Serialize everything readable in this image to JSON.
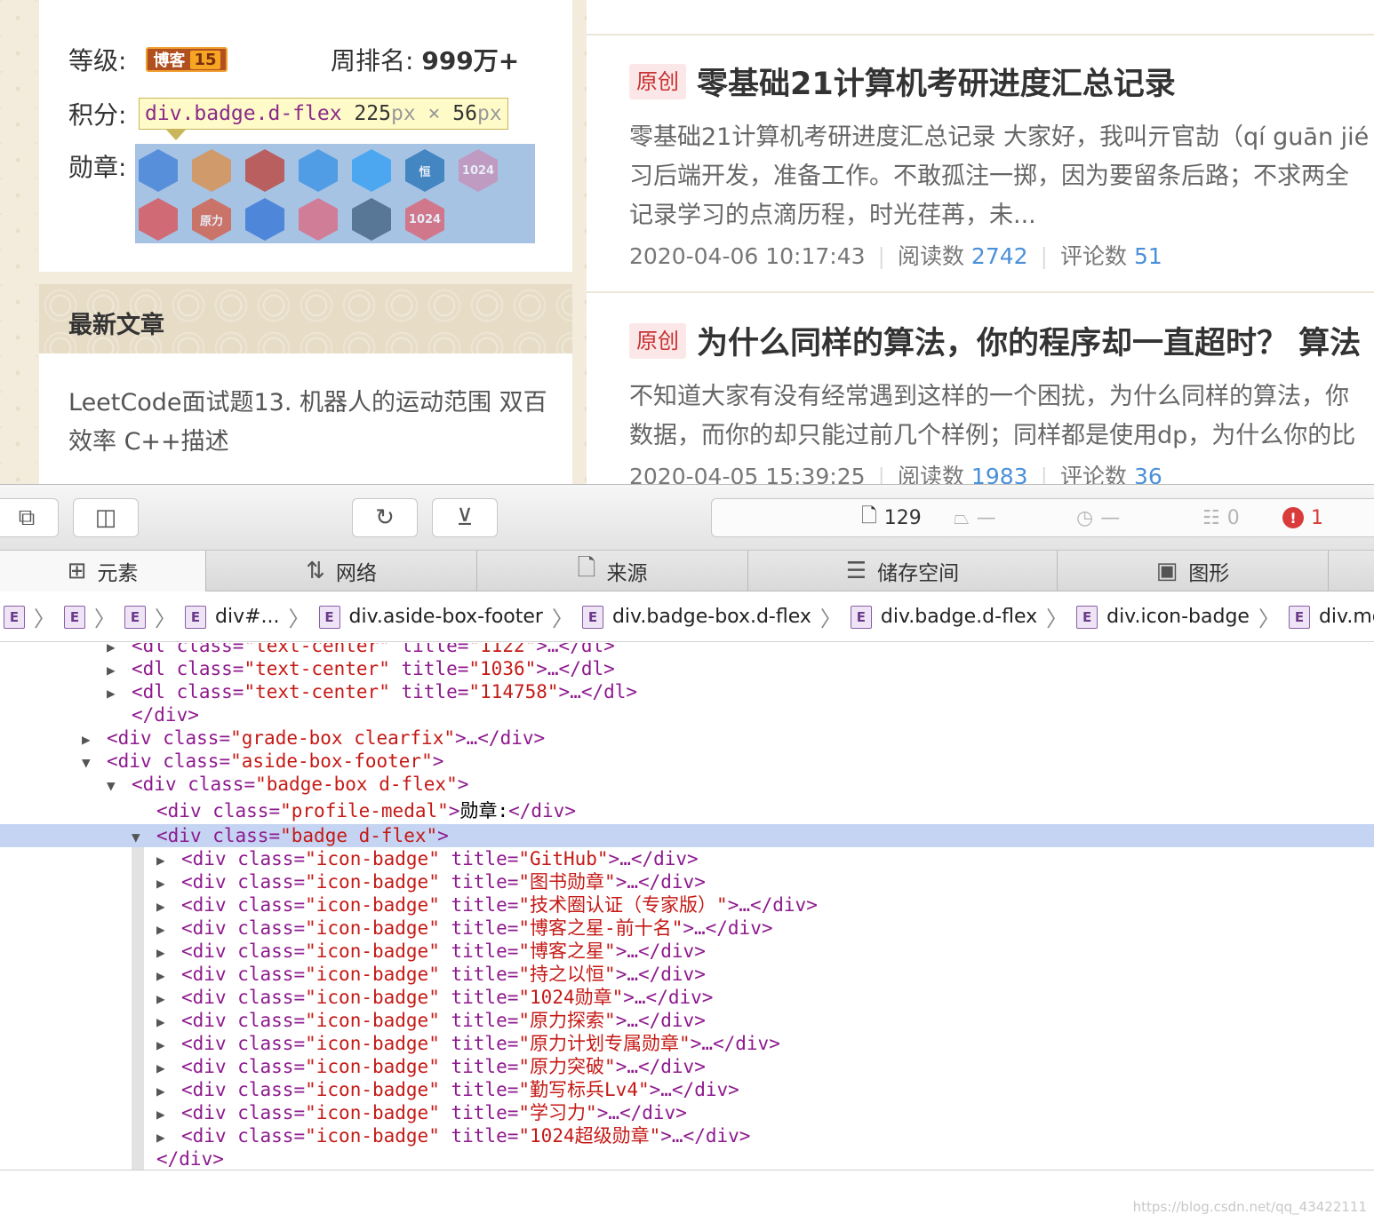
{
  "aside": {
    "level_label": "等级:",
    "level_badge_text": "博客",
    "level_badge_num": "15",
    "rank_label": "周排名:",
    "rank_value": "999万+",
    "points_label": "积分:",
    "medal_label": "勋章:",
    "tooltip": {
      "selector": "div.badge.d-flex",
      "width": "225",
      "height": "56",
      "unit": "px",
      "times": "×"
    },
    "badges": [
      {
        "name": "GitHub",
        "glyph": "",
        "color": "#3a7bd5"
      },
      {
        "name": "图书勋章",
        "glyph": "",
        "color": "#e08b3a"
      },
      {
        "name": "技术圈认证（专家版）",
        "glyph": "",
        "color": "#c0392b"
      },
      {
        "name": "博客之星-前十名",
        "glyph": "",
        "color": "#2f8de4"
      },
      {
        "name": "博客之星",
        "glyph": "",
        "color": "#2a9df4"
      },
      {
        "name": "持之以恒",
        "glyph": "恒",
        "color": "#1f6fb5"
      },
      {
        "name": "1024勋章",
        "glyph": "1024",
        "color": "#c98bb3"
      },
      {
        "name": "原力探索",
        "glyph": "",
        "color": "#e04848"
      },
      {
        "name": "原力计划专属勋章",
        "glyph": "原力",
        "color": "#d8553a"
      },
      {
        "name": "原力突破",
        "glyph": "",
        "color": "#2c6fd6"
      },
      {
        "name": "勤写标兵Lv4",
        "glyph": "",
        "color": "#e0627a"
      },
      {
        "name": "学习力",
        "glyph": "",
        "color": "#3a5a78"
      },
      {
        "name": "1024超级勋章",
        "glyph": "1024",
        "color": "#e25b6a"
      }
    ],
    "latest_title": "最新文章",
    "latest_item": "LeetCode面试题13. 机器人的运动范围 双百效率 C++描述"
  },
  "articles": [
    {
      "tag": "原创",
      "title": "零基础21计算机考研进度汇总记录",
      "excerpt": [
        "零基础21计算机考研进度汇总记录 大家好，我叫亓官劼（qí guān jié",
        "习后端开发，准备工作。不敢孤注一掷，因为要留条后路；不求两全",
        "记录学习的点滴历程，时光荏苒，未..."
      ],
      "date": "2020-04-06 10:17:43",
      "reads_label": "阅读数",
      "reads": "2742",
      "comments_label": "评论数",
      "comments": "51"
    },
    {
      "tag": "原创",
      "title": "为什么同样的算法，你的程序却一直超时？ 算法",
      "excerpt": [
        "不知道大家有没有经常遇到这样的一个困扰，为什么同样的算法，你",
        "数据，而你的却只能过前几个样例；同样都是使用dp，为什么你的比"
      ],
      "date": "2020-04-05 15:39:25",
      "reads_label": "阅读数",
      "reads": "1983",
      "comments_label": "评论数",
      "comments": "36"
    }
  ],
  "devtools": {
    "resource_count": "129",
    "size_dash": "—",
    "time_dash": "—",
    "console_count": "0",
    "error_count": "1",
    "tabs": [
      {
        "label": "元素",
        "icon": "elements-icon",
        "glyph": "⊞"
      },
      {
        "label": "网络",
        "icon": "network-icon",
        "glyph": "⇅"
      },
      {
        "label": "来源",
        "icon": "sources-icon",
        "glyph": "🗋"
      },
      {
        "label": "储存空间",
        "icon": "storage-icon",
        "glyph": "☰"
      },
      {
        "label": "图形",
        "icon": "graphics-icon",
        "glyph": "▣"
      }
    ],
    "breadcrumb": [
      "",
      "",
      "",
      "div#...",
      "div.aside-box-footer",
      "div.badge-box.d-flex",
      "div.badge.d-flex",
      "div.icon-badge",
      "div.mouse-box"
    ],
    "dom_lines": [
      {
        "indent": 120,
        "tri": "▶",
        "tag": "dl",
        "cls": "text-center",
        "title": "1122",
        "tail": ">…</dl>"
      },
      {
        "indent": 120,
        "tri": "▶",
        "tag": "dl",
        "cls": "text-center",
        "title": "1036",
        "tail": ">…</dl>"
      },
      {
        "indent": 120,
        "tri": "▶",
        "tag": "dl",
        "cls": "text-center",
        "title": "114758",
        "tail": ">…</dl>"
      },
      {
        "indent": 120,
        "tri": "",
        "close": "</div>"
      },
      {
        "indent": 92,
        "tri": "▶",
        "tag": "div",
        "cls": "grade-box clearfix",
        "title": "",
        "tail": ">…</div>"
      },
      {
        "indent": 92,
        "tri": "▼",
        "tag": "div",
        "cls": "aside-box-footer",
        "title": "",
        "tail": ">"
      },
      {
        "indent": 120,
        "tri": "▼",
        "tag": "div",
        "cls": "badge-box d-flex",
        "title": "",
        "tail": ">"
      },
      {
        "indent": 148,
        "tri": "",
        "tag": "div",
        "cls": "profile-medal",
        "title": "",
        "tail": ">",
        "text": "勋章:",
        "after": "</div>"
      },
      {
        "indent": 148,
        "tri": "▼",
        "tag": "div",
        "cls": "badge d-flex",
        "title": "",
        "tail": ">",
        "selected": true
      },
      {
        "indent": 176,
        "tri": "▶",
        "tag": "div",
        "cls": "icon-badge",
        "title": "GitHub",
        "tail": ">…</div>"
      },
      {
        "indent": 176,
        "tri": "▶",
        "tag": "div",
        "cls": "icon-badge",
        "title": "图书勋章",
        "tail": ">…</div>"
      },
      {
        "indent": 176,
        "tri": "▶",
        "tag": "div",
        "cls": "icon-badge",
        "title": "技术圈认证（专家版）",
        "tail": ">…</div>"
      },
      {
        "indent": 176,
        "tri": "▶",
        "tag": "div",
        "cls": "icon-badge",
        "title": "博客之星-前十名",
        "tail": ">…</div>"
      },
      {
        "indent": 176,
        "tri": "▶",
        "tag": "div",
        "cls": "icon-badge",
        "title": "博客之星",
        "tail": ">…</div>"
      },
      {
        "indent": 176,
        "tri": "▶",
        "tag": "div",
        "cls": "icon-badge",
        "title": "持之以恒",
        "tail": ">…</div>"
      },
      {
        "indent": 176,
        "tri": "▶",
        "tag": "div",
        "cls": "icon-badge",
        "title": "1024勋章",
        "tail": ">…</div>"
      },
      {
        "indent": 176,
        "tri": "▶",
        "tag": "div",
        "cls": "icon-badge",
        "title": "原力探索",
        "tail": ">…</div>"
      },
      {
        "indent": 176,
        "tri": "▶",
        "tag": "div",
        "cls": "icon-badge",
        "title": "原力计划专属勋章",
        "tail": ">…</div>"
      },
      {
        "indent": 176,
        "tri": "▶",
        "tag": "div",
        "cls": "icon-badge",
        "title": "原力突破",
        "tail": ">…</div>"
      },
      {
        "indent": 176,
        "tri": "▶",
        "tag": "div",
        "cls": "icon-badge",
        "title": "勤写标兵Lv4",
        "tail": ">…</div>"
      },
      {
        "indent": 176,
        "tri": "▶",
        "tag": "div",
        "cls": "icon-badge",
        "title": "学习力",
        "tail": ">…</div>"
      },
      {
        "indent": 176,
        "tri": "▶",
        "tag": "div",
        "cls": "icon-badge",
        "title": "1024超级勋章",
        "tail": ">…</div>"
      },
      {
        "indent": 148,
        "tri": "",
        "close": "</div>"
      }
    ]
  },
  "watermark": "https://blog.csdn.net/qq_43422111"
}
